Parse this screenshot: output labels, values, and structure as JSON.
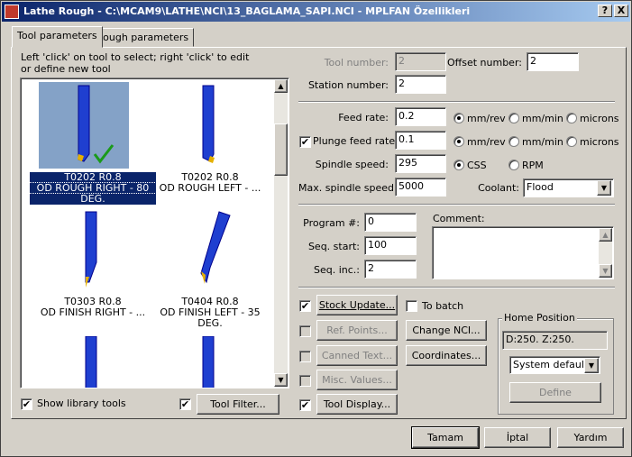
{
  "window": {
    "title": "Lathe Rough - C:\\MCAM9\\LATHE\\NCI\\13_BAGLAMA_SAPI.NCI - MPLFAN Özellikleri",
    "help_btn": "?",
    "close_btn": "X"
  },
  "tabs": [
    "Tool parameters",
    "Rough parameters"
  ],
  "instructions": "Left 'click' on tool to select; right 'click' to edit or define new tool",
  "tools": [
    {
      "line1": "T0202 R0.8",
      "line2": "OD ROUGH RIGHT - 80",
      "line3": "DEG.",
      "selected": true
    },
    {
      "line1": "T0202 R0.8",
      "line2": "OD ROUGH LEFT - ...",
      "line3": ""
    },
    {
      "line1": "T0303 R0.8",
      "line2": "OD FINISH RIGHT - ...",
      "line3": ""
    },
    {
      "line1": "T0404 R0.8",
      "line2": "OD FINISH LEFT - 35 DEG.",
      "line3": ""
    }
  ],
  "show_library": {
    "label": "Show library tools",
    "checked": "✔"
  },
  "tool_filter": {
    "checked": "✔",
    "label": "Tool Filter..."
  },
  "tool_number": {
    "label": "Tool number:",
    "value": "2"
  },
  "offset_number": {
    "label": "Offset number:",
    "value": "2"
  },
  "station_number": {
    "label": "Station number:",
    "value": "2"
  },
  "feed_rate": {
    "label": "Feed rate:",
    "value": "0.2"
  },
  "plunge_feed_rate": {
    "label": "Plunge feed rate:",
    "value": "0.1",
    "checked": "✔"
  },
  "units": {
    "mm_rev": "mm/rev",
    "mm_min": "mm/min",
    "microns": "microns"
  },
  "spindle_speed": {
    "label": "Spindle speed:",
    "value": "295"
  },
  "spindle_mode": {
    "css": "CSS",
    "rpm": "RPM"
  },
  "max_spindle": {
    "label": "Max. spindle speed:",
    "value": "5000"
  },
  "coolant": {
    "label": "Coolant:",
    "value": "Flood"
  },
  "program": {
    "label": "Program #:",
    "value": "0"
  },
  "seq_start": {
    "label": "Seq. start:",
    "value": "100"
  },
  "seq_inc": {
    "label": "Seq. inc.:",
    "value": "2"
  },
  "comment": {
    "label": "Comment:",
    "value": ""
  },
  "buttons": {
    "stock_update": "Stock Update...",
    "ref_points": "Ref. Points...",
    "canned_text": "Canned Text...",
    "misc_values": "Misc. Values...",
    "tool_display": "Tool Display...",
    "change_nci": "Change NCI...",
    "coordinates": "Coordinates...",
    "to_batch": "To batch",
    "check": "✔"
  },
  "home_position": {
    "title": "Home Position",
    "value": "D:250.  Z:250.",
    "dropdown": "System default",
    "define": "Define"
  },
  "footer": {
    "ok": "Tamam",
    "cancel": "İptal",
    "help": "Yardım"
  }
}
